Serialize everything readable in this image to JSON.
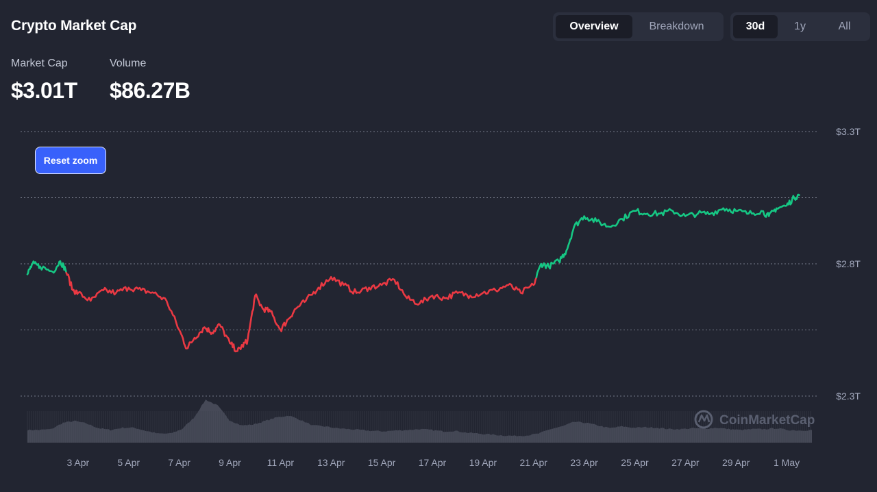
{
  "header": {
    "title": "Crypto Market Cap",
    "view_tabs": [
      {
        "label": "Overview",
        "active": true
      },
      {
        "label": "Breakdown",
        "active": false
      }
    ],
    "range_tabs": [
      {
        "label": "30d",
        "active": true
      },
      {
        "label": "1y",
        "active": false
      },
      {
        "label": "All",
        "active": false
      }
    ]
  },
  "stats": {
    "market_cap_label": "Market Cap",
    "market_cap_value": "$3.01T",
    "volume_label": "Volume",
    "volume_value": "$86.27B"
  },
  "controls": {
    "reset_zoom_label": "Reset zoom"
  },
  "watermark": {
    "text": "CoinMarketCap"
  },
  "colors": {
    "background": "#222531",
    "up": "#16c784",
    "down": "#ea3943",
    "volume": "#4a4e5c",
    "grid": "#9aa0b0",
    "accent": "#3861fb"
  },
  "chart_data": {
    "type": "line",
    "title": "",
    "xlabel": "",
    "ylabel": "",
    "x_ticks": [
      "3 Apr",
      "5 Apr",
      "7 Apr",
      "9 Apr",
      "11 Apr",
      "13 Apr",
      "15 Apr",
      "17 Apr",
      "19 Apr",
      "21 Apr",
      "23 Apr",
      "25 Apr",
      "27 Apr",
      "29 Apr",
      "1 May"
    ],
    "xlim": [
      "1 Apr",
      "2 May"
    ],
    "y_ticks": [
      {
        "value": 3.3,
        "label": "$3.3T"
      },
      {
        "value": 2.8,
        "label": "$2.8T"
      },
      {
        "value": 2.3,
        "label": "$2.3T"
      }
    ],
    "ylim": [
      2.3,
      3.3
    ],
    "grid": true,
    "color_rule": "green above starting value, red below",
    "series": [
      {
        "values_unit": "trillion USD",
        "x": [
          "1 Apr",
          "1.2 Apr",
          "1.5 Apr",
          "2 Apr",
          "2.3 Apr",
          "2.5 Apr",
          "2.8 Apr",
          "3 Apr",
          "3.5 Apr",
          "4 Apr",
          "4.5 Apr",
          "5 Apr",
          "5.5 Apr",
          "6 Apr",
          "6.5 Apr",
          "7 Apr",
          "7.3 Apr",
          "7.6 Apr",
          "8 Apr",
          "8.3 Apr",
          "8.6 Apr",
          "9 Apr",
          "9.3 Apr",
          "9.5 Apr",
          "9.7 Apr",
          "10 Apr",
          "10.3 Apr",
          "10.6 Apr",
          "11 Apr",
          "11.3 Apr",
          "11.6 Apr",
          "12 Apr",
          "12.5 Apr",
          "13 Apr",
          "13.5 Apr",
          "14 Apr",
          "14.5 Apr",
          "15 Apr",
          "15.5 Apr",
          "16 Apr",
          "16.5 Apr",
          "17 Apr",
          "17.5 Apr",
          "18 Apr",
          "18.5 Apr",
          "19 Apr",
          "19.5 Apr",
          "20 Apr",
          "20.5 Apr",
          "21 Apr",
          "21.3 Apr",
          "21.6 Apr",
          "22 Apr",
          "22.3 Apr",
          "22.6 Apr",
          "23 Apr",
          "23.5 Apr",
          "24 Apr",
          "24.5 Apr",
          "25 Apr",
          "25.5 Apr",
          "26 Apr",
          "26.5 Apr",
          "27 Apr",
          "27.5 Apr",
          "28 Apr",
          "28.5 Apr",
          "29 Apr",
          "29.5 Apr",
          "30 Apr",
          "30.3 Apr",
          "30.6 Apr",
          "1 May",
          "1.3 May",
          "1.5 May"
        ],
        "values": [
          2.76,
          2.8,
          2.79,
          2.77,
          2.81,
          2.78,
          2.7,
          2.69,
          2.66,
          2.7,
          2.69,
          2.71,
          2.7,
          2.69,
          2.66,
          2.55,
          2.48,
          2.52,
          2.56,
          2.54,
          2.57,
          2.5,
          2.47,
          2.49,
          2.51,
          2.68,
          2.63,
          2.62,
          2.55,
          2.59,
          2.63,
          2.66,
          2.71,
          2.75,
          2.72,
          2.69,
          2.71,
          2.72,
          2.74,
          2.67,
          2.65,
          2.68,
          2.67,
          2.69,
          2.68,
          2.69,
          2.7,
          2.72,
          2.69,
          2.72,
          2.8,
          2.79,
          2.81,
          2.85,
          2.94,
          2.98,
          2.96,
          2.94,
          2.97,
          3.0,
          2.99,
          2.99,
          3.0,
          2.98,
          2.99,
          2.99,
          3.01,
          3.0,
          2.99,
          3.0,
          2.98,
          3.01,
          3.02,
          3.05,
          3.06
        ]
      }
    ],
    "volume_series": {
      "values_unit": "relative",
      "values": [
        0.28,
        0.28,
        0.3,
        0.44,
        0.48,
        0.42,
        0.32,
        0.28,
        0.33,
        0.33,
        0.26,
        0.2,
        0.2,
        0.3,
        0.55,
        0.95,
        0.82,
        0.5,
        0.38,
        0.4,
        0.48,
        0.56,
        0.6,
        0.5,
        0.38,
        0.36,
        0.32,
        0.3,
        0.28,
        0.26,
        0.25,
        0.27,
        0.28,
        0.3,
        0.28,
        0.25,
        0.26,
        0.22,
        0.2,
        0.18,
        0.16,
        0.15,
        0.16,
        0.2,
        0.3,
        0.36,
        0.46,
        0.44,
        0.38,
        0.32,
        0.36,
        0.33,
        0.34,
        0.33,
        0.3,
        0.3,
        0.32,
        0.31,
        0.33,
        0.3,
        0.28,
        0.3,
        0.3,
        0.32,
        0.28,
        0.27,
        0.28
      ]
    }
  }
}
